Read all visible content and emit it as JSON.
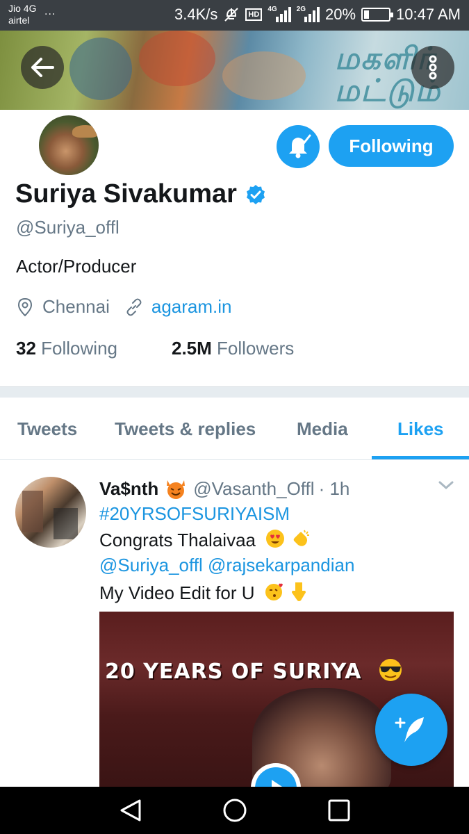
{
  "status_bar": {
    "carrier_line1": "Jio 4G",
    "carrier_line2": "airtel",
    "dots": "...",
    "speed": "3.4K/s",
    "hd": "HD",
    "net1": "4G",
    "net2": "2G",
    "battery": "20%",
    "battery_level": 0.2,
    "time": "10:47 AM"
  },
  "banner": {
    "title_line1": "மகளிர்",
    "title_line2": "மட்டும்"
  },
  "profile": {
    "name": "Suriya Sivakumar",
    "verified_icon": "verified-badge-icon",
    "handle": "@Suriya_offl",
    "bio": "Actor/Producer",
    "location": "Chennai",
    "website": "agaram.in",
    "following_count": "32",
    "following_label": "Following",
    "followers_count": "2.5M",
    "followers_label": "Followers",
    "follow_button": "Following"
  },
  "tabs": [
    {
      "label": "Tweets",
      "active": false
    },
    {
      "label": "Tweets & replies",
      "active": false
    },
    {
      "label": "Media",
      "active": false
    },
    {
      "label": "Likes",
      "active": true
    }
  ],
  "tweet": {
    "display_name": "Va$nth",
    "handle": "@Vasanth_Offl",
    "time": "· 1h",
    "hashtag": "#20YRSOFSURIYAISM",
    "line2": "Congrats Thalaivaa",
    "mention1": "@Suriya_offl",
    "mention2": "@rajsekarpandian",
    "line4": "My Video Edit for U",
    "media_title": "20 YEARS OF SURIYA"
  },
  "colors": {
    "accent": "#1da1f2",
    "link": "#1b95e0",
    "secondary_text": "#657786",
    "primary_text": "#14171a"
  }
}
